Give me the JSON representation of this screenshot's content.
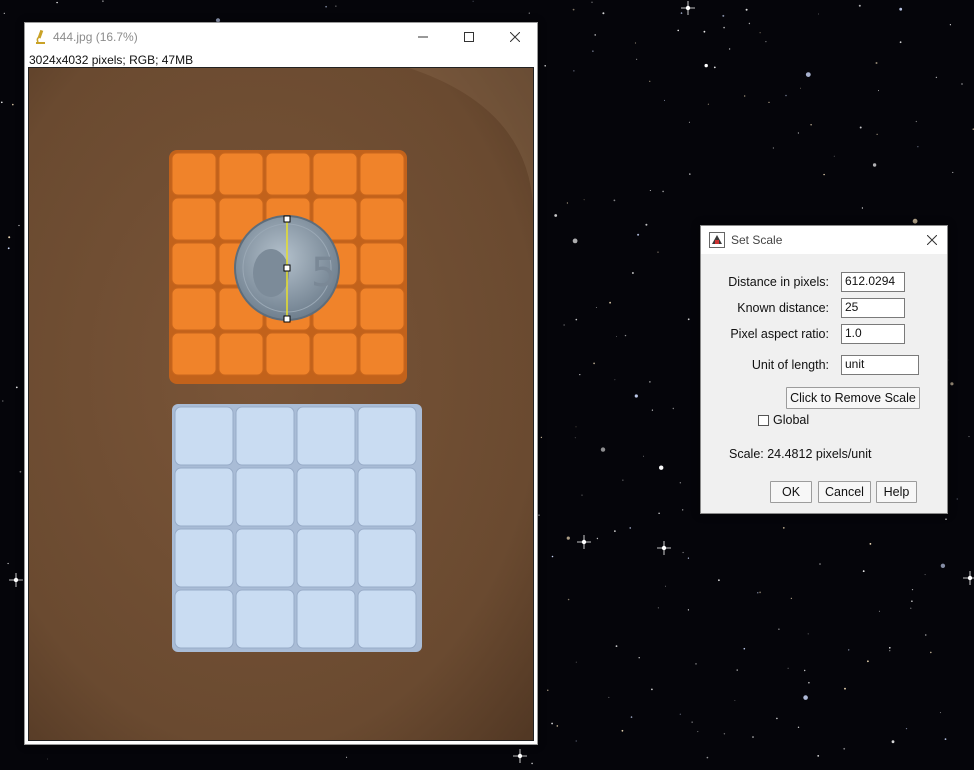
{
  "image_window": {
    "title": "444.jpg (16.7%)",
    "info": "3024x4032 pixels; RGB; 47MB",
    "controls": {
      "minimize": "minimize-icon",
      "maximize": "maximize-icon",
      "close": "close-icon"
    }
  },
  "dialog": {
    "title": "Set Scale",
    "fields": [
      {
        "label": "Distance in pixels:",
        "value": "612.0294"
      },
      {
        "label": "Known distance:",
        "value": "25"
      },
      {
        "label": "Pixel aspect ratio:",
        "value": "1.0"
      },
      {
        "label": "Unit of length:",
        "value": "unit"
      }
    ],
    "remove_scale_label": "Click to Remove Scale",
    "global_label": "Global",
    "global_checked": false,
    "scale_text": "Scale: 24.4812 pixels/unit",
    "buttons": {
      "ok": "OK",
      "cancel": "Cancel",
      "help": "Help"
    }
  },
  "colors": {
    "desktop": "#05050a",
    "table": "#6e4d33",
    "orange_cube": "#f0832a",
    "blue_cube": "#c9dcf2",
    "coin": "#8a9aaa",
    "measure_line": "#e8e02a"
  }
}
